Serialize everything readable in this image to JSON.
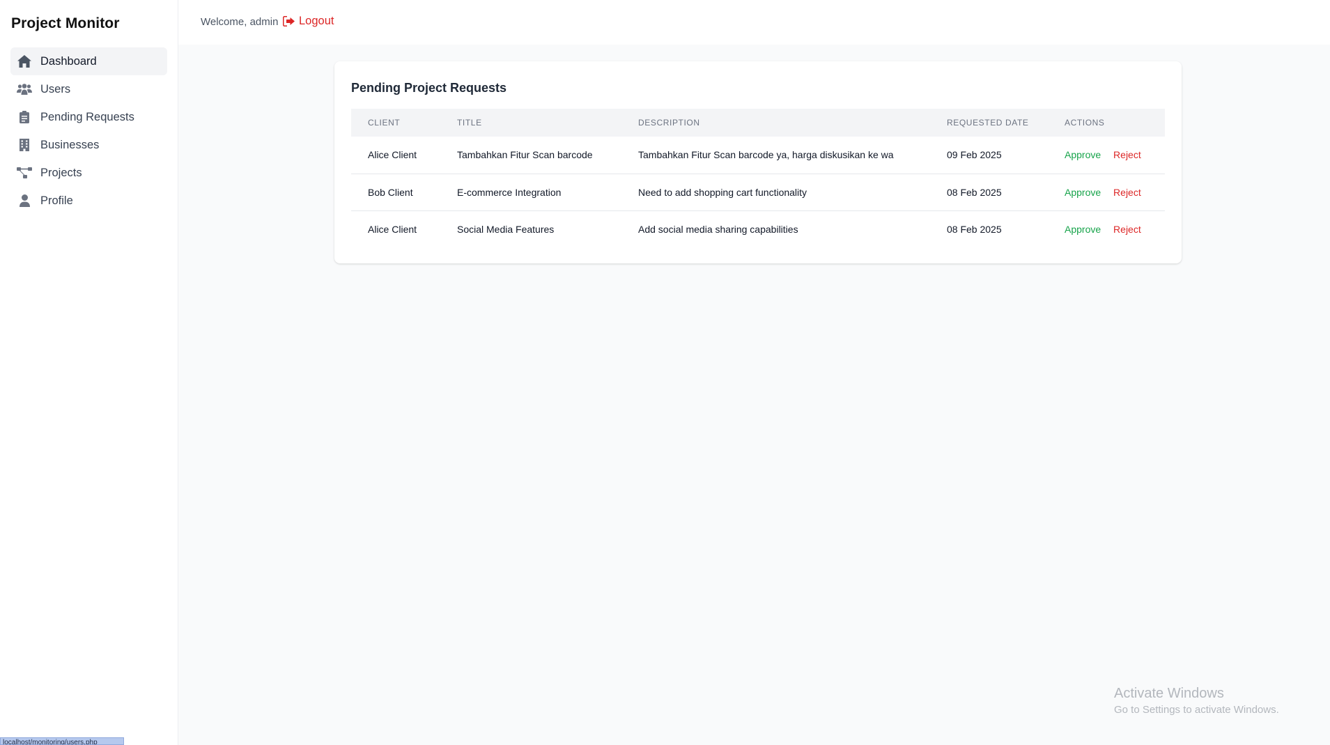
{
  "app": {
    "title": "Project Monitor"
  },
  "sidebar": {
    "items": [
      {
        "label": "Dashboard",
        "icon": "home-icon",
        "active": true
      },
      {
        "label": "Users",
        "icon": "users-icon"
      },
      {
        "label": "Pending Requests",
        "icon": "clipboard-icon"
      },
      {
        "label": "Businesses",
        "icon": "building-icon"
      },
      {
        "label": "Projects",
        "icon": "project-diagram-icon"
      },
      {
        "label": "Profile",
        "icon": "user-icon"
      }
    ]
  },
  "header": {
    "welcome": "Welcome, admin",
    "logout_label": "Logout",
    "logout_icon": "sign-out-icon",
    "logout_color": "#dc2626"
  },
  "main": {
    "card_title": "Pending Project Requests",
    "columns": [
      "CLIENT",
      "TITLE",
      "DESCRIPTION",
      "REQUESTED DATE",
      "ACTIONS"
    ],
    "rows": [
      {
        "client": "Alice Client",
        "title": "Tambahkan Fitur Scan barcode",
        "description": "Tambahkan Fitur Scan barcode ya, harga diskusikan ke wa",
        "date": "09 Feb 2025",
        "approve": "Approve",
        "reject": "Reject"
      },
      {
        "client": "Bob Client",
        "title": "E-commerce Integration",
        "description": "Need to add shopping cart functionality",
        "date": "08 Feb 2025",
        "approve": "Approve",
        "reject": "Reject"
      },
      {
        "client": "Alice Client",
        "title": "Social Media Features",
        "description": "Add social media sharing capabilities",
        "date": "08 Feb 2025",
        "approve": "Approve",
        "reject": "Reject"
      }
    ],
    "approve_color": "#16a34a",
    "reject_color": "#dc2626"
  },
  "watermark": {
    "title": "Activate Windows",
    "subtitle": "Go to Settings to activate Windows."
  },
  "statusbar": {
    "url": "localhost/monitoring/users.php"
  }
}
